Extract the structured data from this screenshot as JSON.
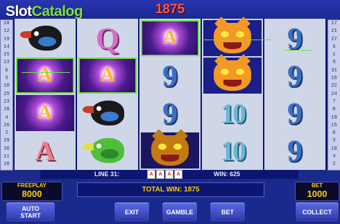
{
  "logo": {
    "part1": "Slot",
    "part2": "Catalog"
  },
  "credit": "1875",
  "paylines": {
    "left": [
      "18",
      "12",
      "19",
      "14",
      "15",
      "13",
      "6",
      "3",
      "10",
      "25",
      "23",
      "28",
      "4",
      "26",
      "2",
      "29",
      "30",
      "11",
      "20"
    ],
    "right": [
      "17",
      "21",
      "27",
      "5",
      "1",
      "9",
      "31",
      "16",
      "22",
      "24",
      "7",
      "8",
      "19",
      "15",
      "6",
      "3",
      "10",
      "4",
      "2"
    ]
  },
  "reels": [
    [
      {
        "type": "bird-black"
      },
      {
        "type": "star",
        "win": true,
        "glyph": "A"
      },
      {
        "type": "star",
        "glyph": "A"
      },
      {
        "type": "letter",
        "glyph": "A"
      }
    ],
    [
      {
        "type": "letter",
        "glyph": "Q"
      },
      {
        "type": "star",
        "win": true,
        "glyph": "A"
      },
      {
        "type": "bird-black"
      },
      {
        "type": "bird-green"
      }
    ],
    [
      {
        "type": "star",
        "win": true,
        "glyph": "A"
      },
      {
        "type": "nine",
        "glyph": "9"
      },
      {
        "type": "nine",
        "glyph": "9"
      },
      {
        "type": "cat-dark"
      }
    ],
    [
      {
        "type": "cat"
      },
      {
        "type": "cat"
      },
      {
        "type": "ten",
        "glyph": "10"
      },
      {
        "type": "ten",
        "glyph": "10"
      }
    ],
    [
      {
        "type": "nine",
        "glyph": "9"
      },
      {
        "type": "nine",
        "glyph": "9"
      },
      {
        "type": "nine",
        "glyph": "9"
      },
      {
        "type": "nine",
        "glyph": "9"
      }
    ]
  ],
  "info": {
    "line": "LINE 31:",
    "aces": [
      "A",
      "A",
      "A",
      "A"
    ],
    "win": "WIN: 625"
  },
  "freeplay": {
    "label": "FREEPLAY",
    "value": "8000"
  },
  "total_win": "TOTAL WIN: 1875",
  "bet_panel": {
    "label": "BET",
    "value": "1000"
  },
  "buttons": {
    "auto_start_1": "AUTO",
    "auto_start_2": "START",
    "exit": "EXIT",
    "gamble": "GAMBLE",
    "bet": "BET",
    "collect": "COLLECT"
  },
  "colors": {
    "background": "#1a2a8c",
    "credit": "#ff5a3a",
    "win_border": "#6fe040",
    "panel_text": "#ffd000"
  }
}
